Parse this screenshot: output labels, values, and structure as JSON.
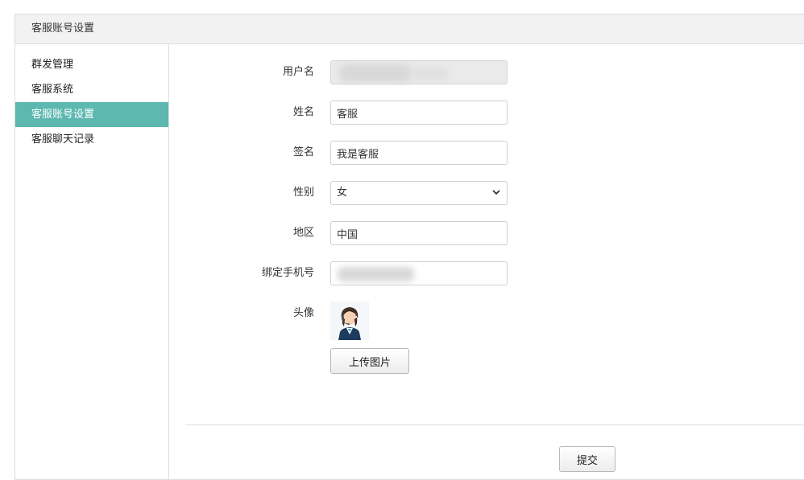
{
  "page": {
    "title": "客服账号设置"
  },
  "sidebar": {
    "items": [
      {
        "label": "群发管理",
        "active": false
      },
      {
        "label": "客服系统",
        "active": false
      },
      {
        "label": "客服账号设置",
        "active": true
      },
      {
        "label": "客服聊天记录",
        "active": false
      }
    ]
  },
  "form": {
    "username": {
      "label": "用户名",
      "value": ""
    },
    "name": {
      "label": "姓名",
      "value": "客服"
    },
    "signature": {
      "label": "签名",
      "value": "我是客服"
    },
    "gender": {
      "label": "性别",
      "value": "女"
    },
    "region": {
      "label": "地区",
      "value": "中国"
    },
    "phone": {
      "label": "绑定手机号",
      "value": ""
    },
    "avatar": {
      "label": "头像"
    },
    "upload_label": "上传图片",
    "submit_label": "提交"
  },
  "colors": {
    "accent": "#5cb8b0",
    "header_bg": "#f2f2f2",
    "border": "#dcdcdc"
  }
}
